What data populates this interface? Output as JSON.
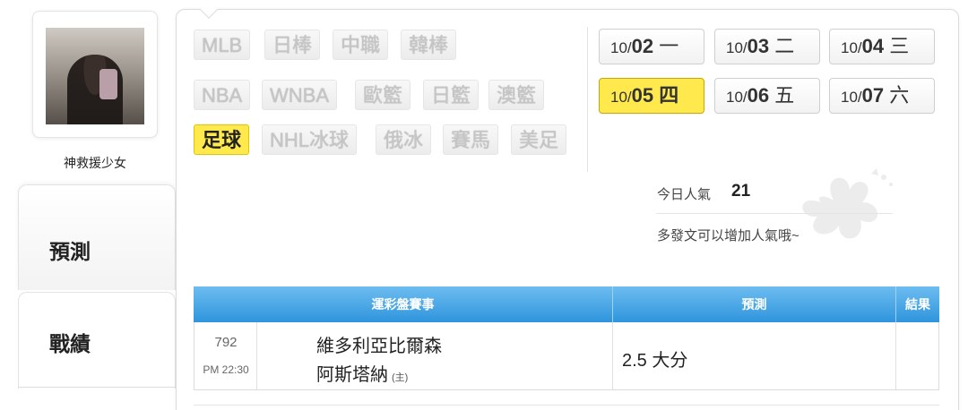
{
  "profile": {
    "name": "神救援少女"
  },
  "sidebar": {
    "tabs": [
      {
        "label": "預測"
      },
      {
        "label": "戰績"
      }
    ]
  },
  "sports": [
    {
      "label": "MLB",
      "active": false
    },
    {
      "label": "日棒",
      "active": false
    },
    {
      "label": "中職",
      "active": false
    },
    {
      "label": "韓棒",
      "active": false
    },
    {
      "label": "NBA",
      "active": false
    },
    {
      "label": "WNBA",
      "active": false
    },
    {
      "label": "歐籃",
      "active": false
    },
    {
      "label": "日籃",
      "active": false
    },
    {
      "label": "澳籃",
      "active": false
    },
    {
      "label": "足球",
      "active": true
    },
    {
      "label": "NHL冰球",
      "active": false
    },
    {
      "label": "俄冰",
      "active": false
    },
    {
      "label": "賽馬",
      "active": false
    },
    {
      "label": "美足",
      "active": false
    }
  ],
  "dates": [
    {
      "month": "10/",
      "day": "02",
      "weekday": "一",
      "active": false
    },
    {
      "month": "10/",
      "day": "03",
      "weekday": "二",
      "active": false
    },
    {
      "month": "10/",
      "day": "04",
      "weekday": "三",
      "active": false
    },
    {
      "month": "10/",
      "day": "05",
      "weekday": "四",
      "active": true
    },
    {
      "month": "10/",
      "day": "06",
      "weekday": "五",
      "active": false
    },
    {
      "month": "10/",
      "day": "07",
      "weekday": "六",
      "active": false
    }
  ],
  "popularity": {
    "label": "今日人氣",
    "value": "21",
    "hint": "多發文可以增加人氣哦~"
  },
  "table": {
    "headers": {
      "event": "運彩盤賽事",
      "prediction": "預測",
      "result": "結果"
    },
    "rows": [
      {
        "number": "792",
        "time": "PM 22:30",
        "team_away": "維多利亞比爾森",
        "team_home": "阿斯塔納",
        "home_tag": "(主)",
        "prediction": "2.5 大分",
        "result": ""
      }
    ]
  },
  "colors": {
    "accent_yellow": "#ffe94c",
    "header_blue": "#2f95dc"
  }
}
